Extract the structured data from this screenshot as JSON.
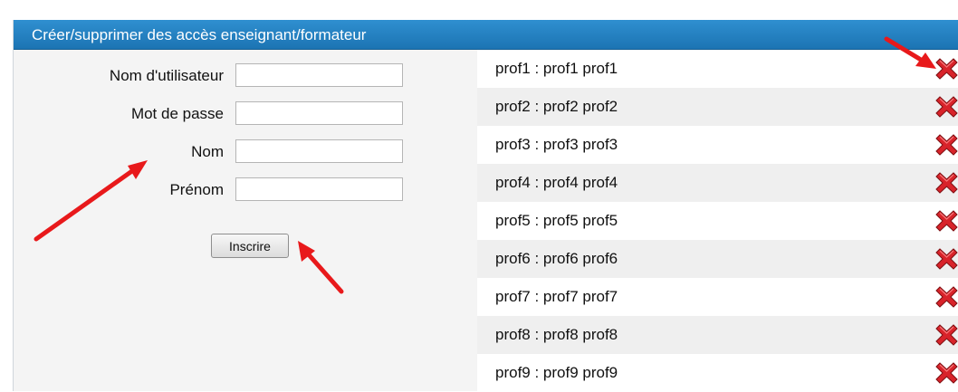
{
  "header": {
    "title": "Créer/supprimer des accès enseignant/formateur"
  },
  "form": {
    "fields": [
      {
        "label": "Nom d'utilisateur",
        "value": ""
      },
      {
        "label": "Mot de passe",
        "value": ""
      },
      {
        "label": "Nom",
        "value": ""
      },
      {
        "label": "Prénom",
        "value": ""
      }
    ],
    "submit_label": "Inscrire"
  },
  "users": [
    {
      "text": "prof1 : prof1 prof1",
      "icon": "delete-x-icon"
    },
    {
      "text": "prof2 : prof2 prof2",
      "icon": "delete-x-icon"
    },
    {
      "text": "prof3 : prof3 prof3",
      "icon": "delete-x-icon"
    },
    {
      "text": "prof4 : prof4 prof4",
      "icon": "delete-x-icon"
    },
    {
      "text": "prof5 : prof5 prof5",
      "icon": "delete-x-icon"
    },
    {
      "text": "prof6 : prof6 prof6",
      "icon": "delete-x-icon"
    },
    {
      "text": "prof7 : prof7 prof7",
      "icon": "delete-x-icon"
    },
    {
      "text": "prof8 : prof8 prof8",
      "icon": "delete-x-icon"
    },
    {
      "text": "prof9 : prof9 prof9",
      "icon": "delete-x-icon"
    }
  ],
  "colors": {
    "header": "#1c74b3",
    "annotation_arrow": "#e8191b",
    "delete_icon": "#d8232a"
  }
}
